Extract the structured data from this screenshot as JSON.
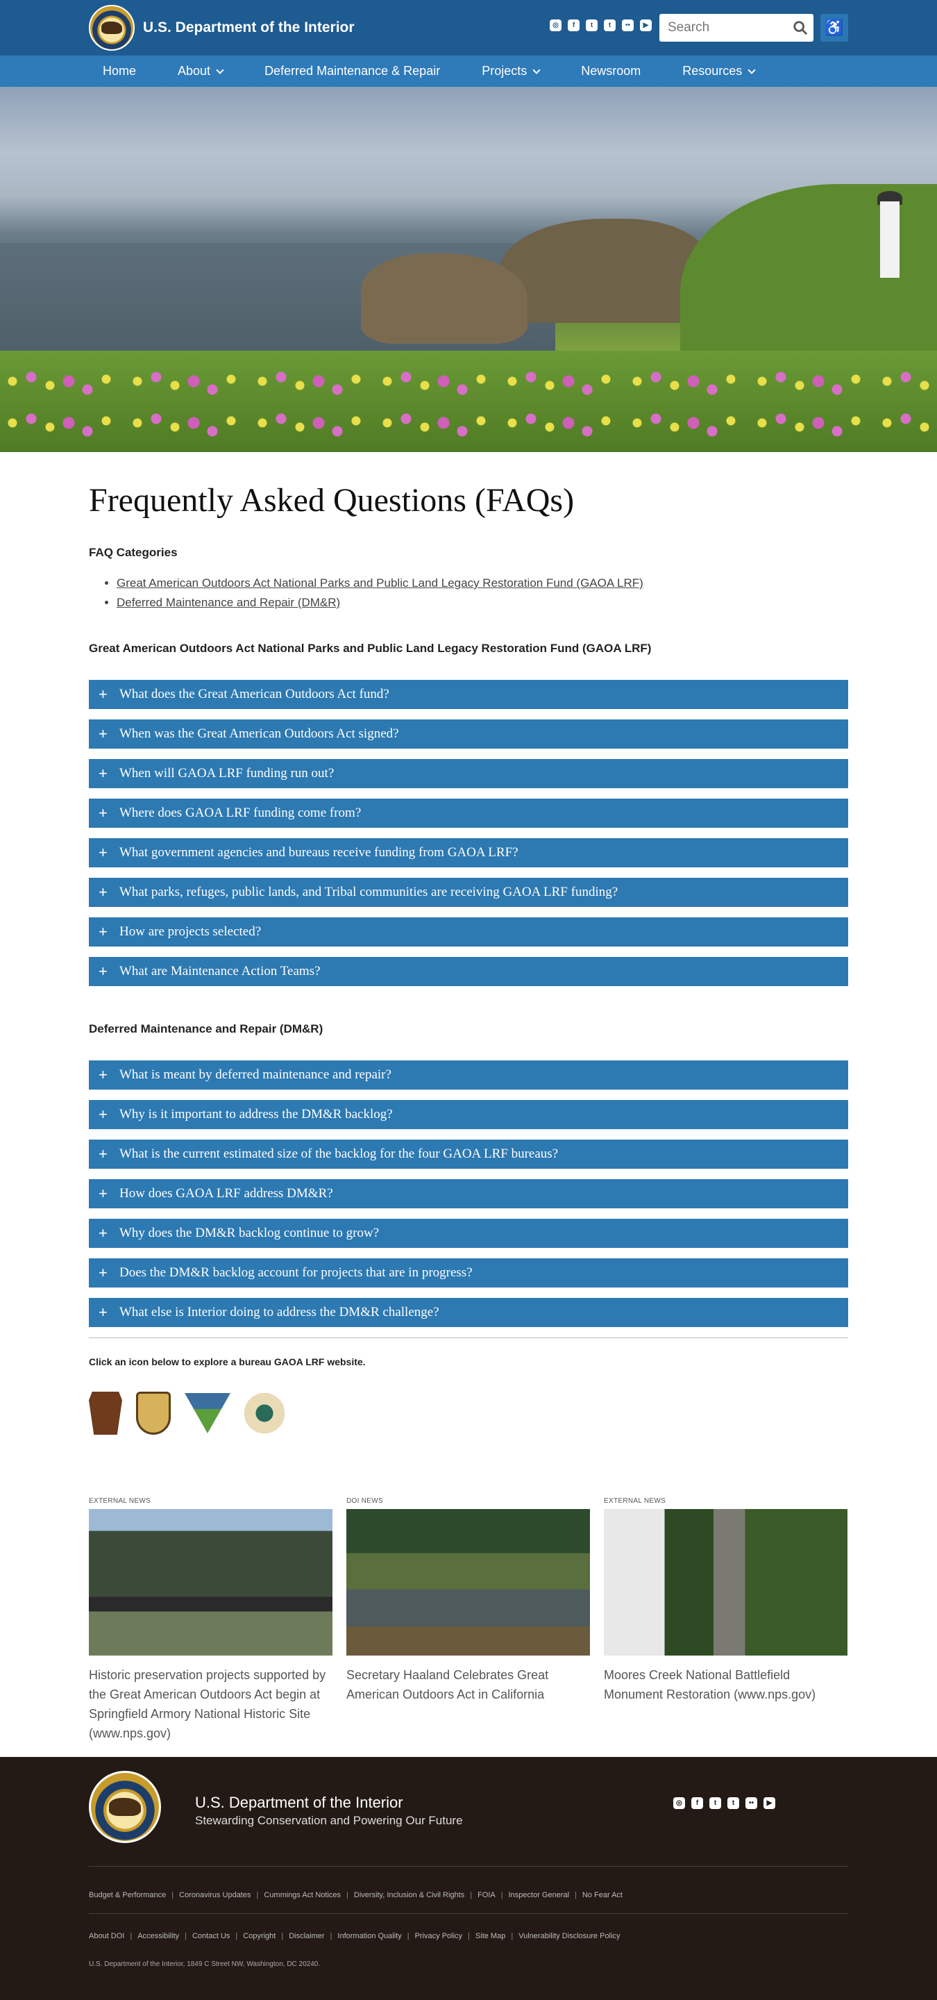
{
  "header": {
    "title": "U.S. Department of the Interior",
    "socials": [
      "instagram-icon",
      "facebook-icon",
      "twitter-icon",
      "tumblr-icon",
      "flickr-icon",
      "youtube-icon"
    ],
    "search_placeholder": "Search"
  },
  "nav": {
    "items": [
      {
        "label": "Home",
        "dropdown": false
      },
      {
        "label": "About",
        "dropdown": true
      },
      {
        "label": "Deferred Maintenance & Repair",
        "dropdown": false
      },
      {
        "label": "Projects",
        "dropdown": true
      },
      {
        "label": "Newsroom",
        "dropdown": false
      },
      {
        "label": "Resources",
        "dropdown": true
      }
    ]
  },
  "main": {
    "title": "Frequently Asked Questions (FAQs)",
    "categories_label": "FAQ Categories",
    "categories": [
      "Great American Outdoors Act National Parks and Public Land Legacy Restoration Fund (GAOA LRF)",
      "Deferred Maintenance and Repair (DM&R)"
    ],
    "sections": [
      {
        "heading": "Great American Outdoors Act National Parks and Public Land Legacy Restoration Fund (GAOA LRF)",
        "questions": [
          "What does the Great American Outdoors Act fund?",
          "When was the Great American Outdoors Act signed?",
          "When will GAOA LRF funding run out?",
          "Where does GAOA LRF funding come from?",
          "What government agencies and bureaus receive funding from GAOA LRF?",
          "What parks, refuges, public lands, and Tribal communities are receiving GAOA LRF funding?",
          "How are projects selected?",
          "What are Maintenance Action Teams?"
        ]
      },
      {
        "heading": "Deferred Maintenance and Repair (DM&R)",
        "questions": [
          "What is meant by deferred maintenance and repair?",
          "Why is it important to address the DM&R backlog?",
          "What is the current estimated size of the backlog for the four GAOA LRF bureaus?",
          "How does GAOA LRF address DM&R?",
          "Why does the DM&R backlog continue to grow?",
          "Does the DM&R backlog account for projects that are in progress?",
          "What else is Interior doing to address the DM&R challenge?"
        ]
      }
    ],
    "bureau_note": "Click an icon below to explore a bureau GAOA LRF website.",
    "bureaus": [
      "nps-logo",
      "fws-logo",
      "blm-logo",
      "bie-logo"
    ]
  },
  "news": [
    {
      "tag": "EXTERNAL NEWS",
      "title": "Historic preservation projects supported by the Great American Outdoors Act begin at Springfield Armory National Historic Site (www.nps.gov)"
    },
    {
      "tag": "DOI NEWS",
      "title": "Secretary Haaland Celebrates Great American Outdoors Act in California"
    },
    {
      "tag": "EXTERNAL NEWS",
      "title": "Moores Creek National Battlefield Monument Restoration (www.nps.gov)"
    }
  ],
  "footer": {
    "title": "U.S. Department of the Interior",
    "tagline": "Stewarding Conservation and Powering Our Future",
    "links_row1": [
      "Budget & Performance",
      "Coronavirus Updates",
      "Cummings Act Notices",
      "Diversity, Inclusion & Civil Rights",
      "FOIA",
      "Inspector General",
      "No Fear Act"
    ],
    "links_row2": [
      "About DOI",
      "Accessibility",
      "Contact Us",
      "Copyright",
      "Disclaimer",
      "Information Quality",
      "Privacy Policy",
      "Site Map",
      "Vulnerability Disclosure Policy"
    ],
    "address": "U.S. Department of the Interior, 1849 C Street NW, Washington, DC 20240."
  }
}
